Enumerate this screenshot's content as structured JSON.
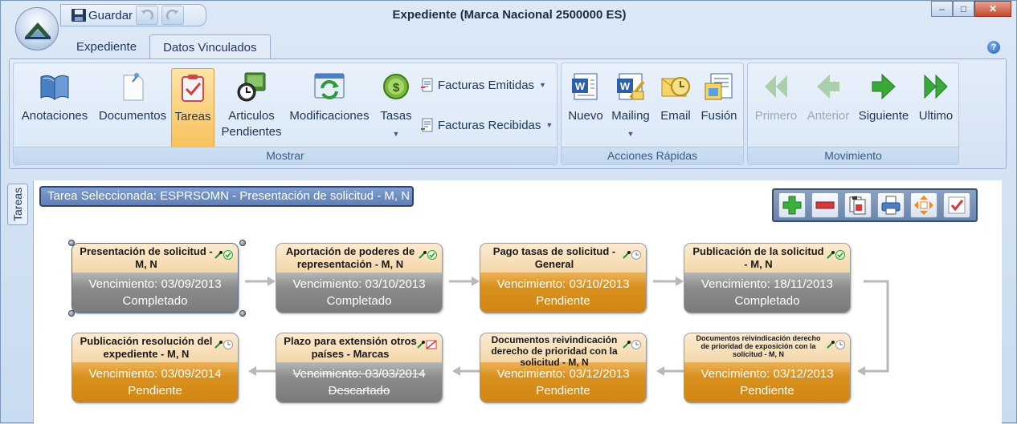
{
  "window": {
    "title": "Expediente (Marca Nacional 2500000 ES)",
    "controls": {
      "minimize": "–",
      "maximize": "□",
      "close": "✕"
    }
  },
  "qat": {
    "save_label": "Guardar"
  },
  "tabs": [
    {
      "label": "Expediente",
      "active": false
    },
    {
      "label": "Datos Vinculados",
      "active": true
    }
  ],
  "help": "?",
  "ribbon": {
    "groups": {
      "mostrar": "Mostrar",
      "acciones": "Acciones Rápidas",
      "movimiento": "Movimiento"
    },
    "mostrar": {
      "anotaciones": "Anotaciones",
      "documentos": "Documentos",
      "tareas": "Tareas",
      "articulos_1": "Articulos",
      "articulos_2": "Pendientes",
      "modificaciones": "Modificaciones",
      "tasas": "Tasas",
      "facturas_emitidas": "Facturas Emitidas",
      "facturas_recibidas": "Facturas Recibidas"
    },
    "acciones": {
      "nuevo": "Nuevo",
      "mailing": "Mailing",
      "email": "Email",
      "fusion": "Fusión"
    },
    "movimiento": {
      "primero": "Primero",
      "anterior": "Anterior",
      "siguiente": "Siguiente",
      "ultimo": "Ultimo"
    }
  },
  "sidetab": "Tareas",
  "selected_task": "Tarea Seleccionada: ESPRSOMN - Presentación de solicitud - M, N",
  "tasks": [
    {
      "title": "Presentación de solicitud - M, N",
      "due": "Vencimiento: 03/09/2013",
      "status": "Completado",
      "state_icon": "check-icon",
      "color": "#8c8c8c"
    },
    {
      "title": "Aportación de poderes de representación - M, N",
      "due": "Vencimiento: 03/10/2013",
      "status": "Completado",
      "state_icon": "check-icon",
      "color": "#8c8c8c"
    },
    {
      "title": "Pago tasas de solicitud - General",
      "due": "Vencimiento: 03/10/2013",
      "status": "Pendiente",
      "state_icon": "clock-icon",
      "color": "#d9901c"
    },
    {
      "title": "Publicación de la solicitud - M, N",
      "due": "Vencimiento: 18/11/2013",
      "status": "Completado",
      "state_icon": "check-icon",
      "color": "#8c8c8c"
    },
    {
      "title": "Publicación resolución del expediente - M, N",
      "due": "Vencimiento: 03/09/2014",
      "status": "Pendiente",
      "state_icon": "clock-icon",
      "color": "#d9901c"
    },
    {
      "title": "Plazo para extensión otros países - Marcas",
      "due": "Vencimiento: 03/03/2014",
      "status": "Descartado",
      "state_icon": "discard-icon",
      "color": "#8c8c8c"
    },
    {
      "title": "Documentos reivindicación derecho de prioridad con la solicitud - M, N",
      "due": "Vencimiento: 03/12/2013",
      "status": "Pendiente",
      "state_icon": "clock-icon",
      "color": "#d9901c"
    },
    {
      "title": "Documentos reivindicación derecho de prioridad de exposición con la solicitud - M, N",
      "due": "Vencimiento: 03/12/2013",
      "status": "Pendiente",
      "state_icon": "clock-icon",
      "color": "#d9901c"
    }
  ]
}
